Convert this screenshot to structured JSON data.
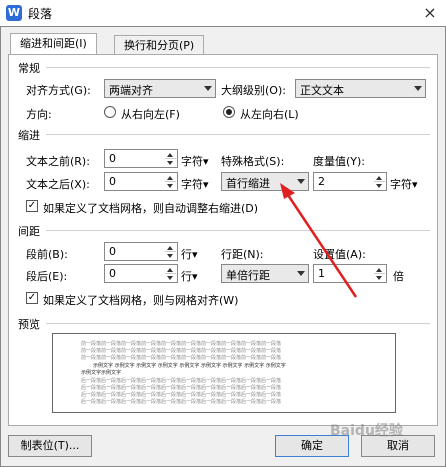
{
  "window": {
    "title": "段落",
    "close": "×",
    "logo": "W"
  },
  "tabs": [
    {
      "label": "缩进和间距(I)"
    },
    {
      "label": "换行和分页(P)"
    }
  ],
  "general": {
    "section": "常规",
    "align_label": "对齐方式(G):",
    "align_value": "两端对齐",
    "outline_label": "大纲级别(O):",
    "outline_value": "正文文本",
    "direction_label": "方向:",
    "rtl_label": "从右向左(F)",
    "ltr_label": "从左向右(L)"
  },
  "indent": {
    "section": "缩进",
    "before_label": "文本之前(R):",
    "before_value": "0",
    "before_unit": "字符▾",
    "after_label": "文本之后(X):",
    "after_value": "0",
    "after_unit": "字符▾",
    "special_label": "特殊格式(S):",
    "special_value": "首行缩进",
    "measure_label": "度量值(Y):",
    "measure_value": "2",
    "measure_unit": "字符▾",
    "auto_adjust": "如果定义了文档网格，则自动调整右缩进(D)"
  },
  "spacing": {
    "section": "间距",
    "before_label": "段前(B):",
    "before_value": "0",
    "before_unit": "行▾",
    "after_label": "段后(E):",
    "after_value": "0",
    "after_unit": "行▾",
    "line_label": "行距(N):",
    "line_value": "单倍行距",
    "setting_label": "设置值(A):",
    "setting_value": "1",
    "setting_unit": "倍",
    "snap": "如果定义了文档网格，则与网格对齐(W)"
  },
  "preview": {
    "section": "预览",
    "prev_line": "前一段落前一段落前一段落前一段落前一段落前一段落前一段落前一段落前一段落前一段落",
    "sample_line": "示例文字 示例文字 示例文字 示例文字 示例文字 示例文字 示例文字 示例文字 示例文字",
    "sample_tail": "示例文字示例文字",
    "next_line": "后一段落后一段落后一段落后一段落后一段落后一段落后一段落后一段落后一段落后一段落"
  },
  "buttons": {
    "tabs_label": "制表位(T)...",
    "ok": "确定",
    "cancel": "取消"
  },
  "watermark": "Baidu经验"
}
